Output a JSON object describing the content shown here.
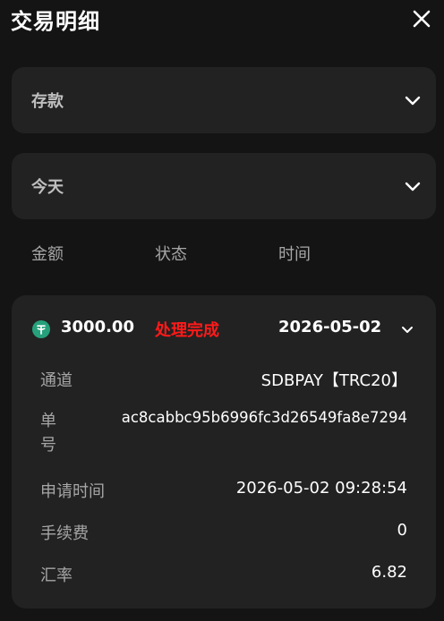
{
  "header": {
    "title": "交易明细",
    "close_icon": "close-icon"
  },
  "filters": {
    "type": {
      "value": "存款"
    },
    "period": {
      "value": "今天"
    }
  },
  "columns": [
    "金额",
    "状态",
    "时间"
  ],
  "transaction": {
    "coin_icon": "tether-icon",
    "amount": "3000.00",
    "status": "处理完成",
    "status_color": "#ff1a1a",
    "date": "2026-05-02",
    "details": [
      {
        "label": "通道",
        "value": "SDBPAY【TRC20】"
      },
      {
        "label": "单号",
        "value": "ac8cabbc95b6996fc3d26549fa8e7294"
      },
      {
        "label": "申请时间",
        "value": "2026-05-02 09:28:54"
      },
      {
        "label": "手续费",
        "value": "0"
      },
      {
        "label": "汇率",
        "value": "6.82"
      }
    ]
  },
  "colors": {
    "background": "#141414",
    "panel": "#222222",
    "muted_text": "#a6a6a6",
    "coin": "#26a17b"
  }
}
